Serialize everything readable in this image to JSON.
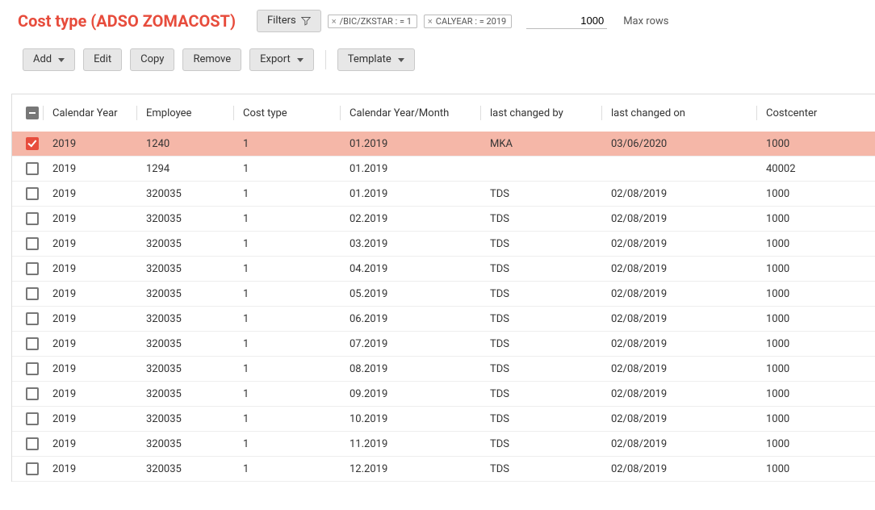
{
  "header": {
    "title": "Cost type (ADSO ZOMACOST)",
    "filters_label": "Filters",
    "chips": [
      "/BIC/ZKSTAR : = 1",
      "CALYEAR : = 2019"
    ],
    "maxrows_value": "1000",
    "maxrows_label": "Max rows"
  },
  "toolbar": {
    "add": "Add",
    "edit": "Edit",
    "copy": "Copy",
    "remove": "Remove",
    "export": "Export",
    "template": "Template"
  },
  "columns": [
    "Calendar Year",
    "Employee",
    "Cost type",
    "Calendar Year/Month",
    "last changed by",
    "last changed on",
    "Costcenter"
  ],
  "rows": [
    {
      "selected": true,
      "cells": [
        "2019",
        "1240",
        "1",
        "01.2019",
        "MKA",
        "03/06/2020",
        "1000"
      ]
    },
    {
      "selected": false,
      "cells": [
        "2019",
        "1294",
        "1",
        "01.2019",
        "",
        "",
        "40002"
      ]
    },
    {
      "selected": false,
      "cells": [
        "2019",
        "320035",
        "1",
        "01.2019",
        "TDS",
        "02/08/2019",
        "1000"
      ]
    },
    {
      "selected": false,
      "cells": [
        "2019",
        "320035",
        "1",
        "02.2019",
        "TDS",
        "02/08/2019",
        "1000"
      ]
    },
    {
      "selected": false,
      "cells": [
        "2019",
        "320035",
        "1",
        "03.2019",
        "TDS",
        "02/08/2019",
        "1000"
      ]
    },
    {
      "selected": false,
      "cells": [
        "2019",
        "320035",
        "1",
        "04.2019",
        "TDS",
        "02/08/2019",
        "1000"
      ]
    },
    {
      "selected": false,
      "cells": [
        "2019",
        "320035",
        "1",
        "05.2019",
        "TDS",
        "02/08/2019",
        "1000"
      ]
    },
    {
      "selected": false,
      "cells": [
        "2019",
        "320035",
        "1",
        "06.2019",
        "TDS",
        "02/08/2019",
        "1000"
      ]
    },
    {
      "selected": false,
      "cells": [
        "2019",
        "320035",
        "1",
        "07.2019",
        "TDS",
        "02/08/2019",
        "1000"
      ]
    },
    {
      "selected": false,
      "cells": [
        "2019",
        "320035",
        "1",
        "08.2019",
        "TDS",
        "02/08/2019",
        "1000"
      ]
    },
    {
      "selected": false,
      "cells": [
        "2019",
        "320035",
        "1",
        "09.2019",
        "TDS",
        "02/08/2019",
        "1000"
      ]
    },
    {
      "selected": false,
      "cells": [
        "2019",
        "320035",
        "1",
        "10.2019",
        "TDS",
        "02/08/2019",
        "1000"
      ]
    },
    {
      "selected": false,
      "cells": [
        "2019",
        "320035",
        "1",
        "11.2019",
        "TDS",
        "02/08/2019",
        "1000"
      ]
    },
    {
      "selected": false,
      "cells": [
        "2019",
        "320035",
        "1",
        "12.2019",
        "TDS",
        "02/08/2019",
        "1000"
      ]
    }
  ]
}
